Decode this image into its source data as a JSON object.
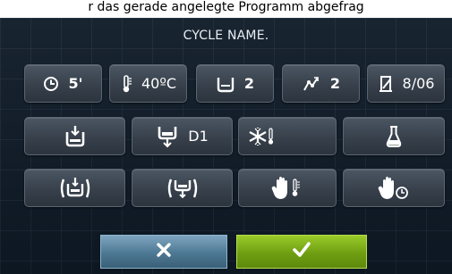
{
  "caption": "r das gerade angelegte Programm abgefrag",
  "screen_title": "CYCLE NAME.",
  "row1": {
    "time": "5'",
    "temperature": "40ºC",
    "rinse": "2",
    "spin": "2",
    "dosing": "8/06"
  },
  "row2": {
    "drain_value": "D1"
  },
  "footer": {
    "cancel_icon": "x-icon",
    "confirm_icon": "check-icon",
    "cancel_color": "#4d7893",
    "confirm_color": "#6f9e12"
  }
}
